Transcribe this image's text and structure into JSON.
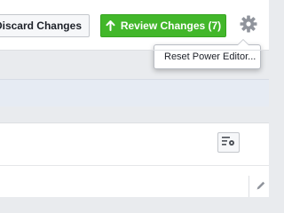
{
  "toolbar": {
    "discard_label": "Discard Changes",
    "review_label": "Review Changes (7)",
    "review_icon": "arrow-up-icon",
    "settings_icon": "gear-icon"
  },
  "menu": {
    "items": [
      {
        "label": "Reset Power Editor..."
      }
    ]
  },
  "card": {
    "settings_icon": "column-settings-icon",
    "edit_icon": "pencil-icon"
  },
  "colors": {
    "review_green": "#42b72a",
    "gear_gray": "#90949c"
  }
}
